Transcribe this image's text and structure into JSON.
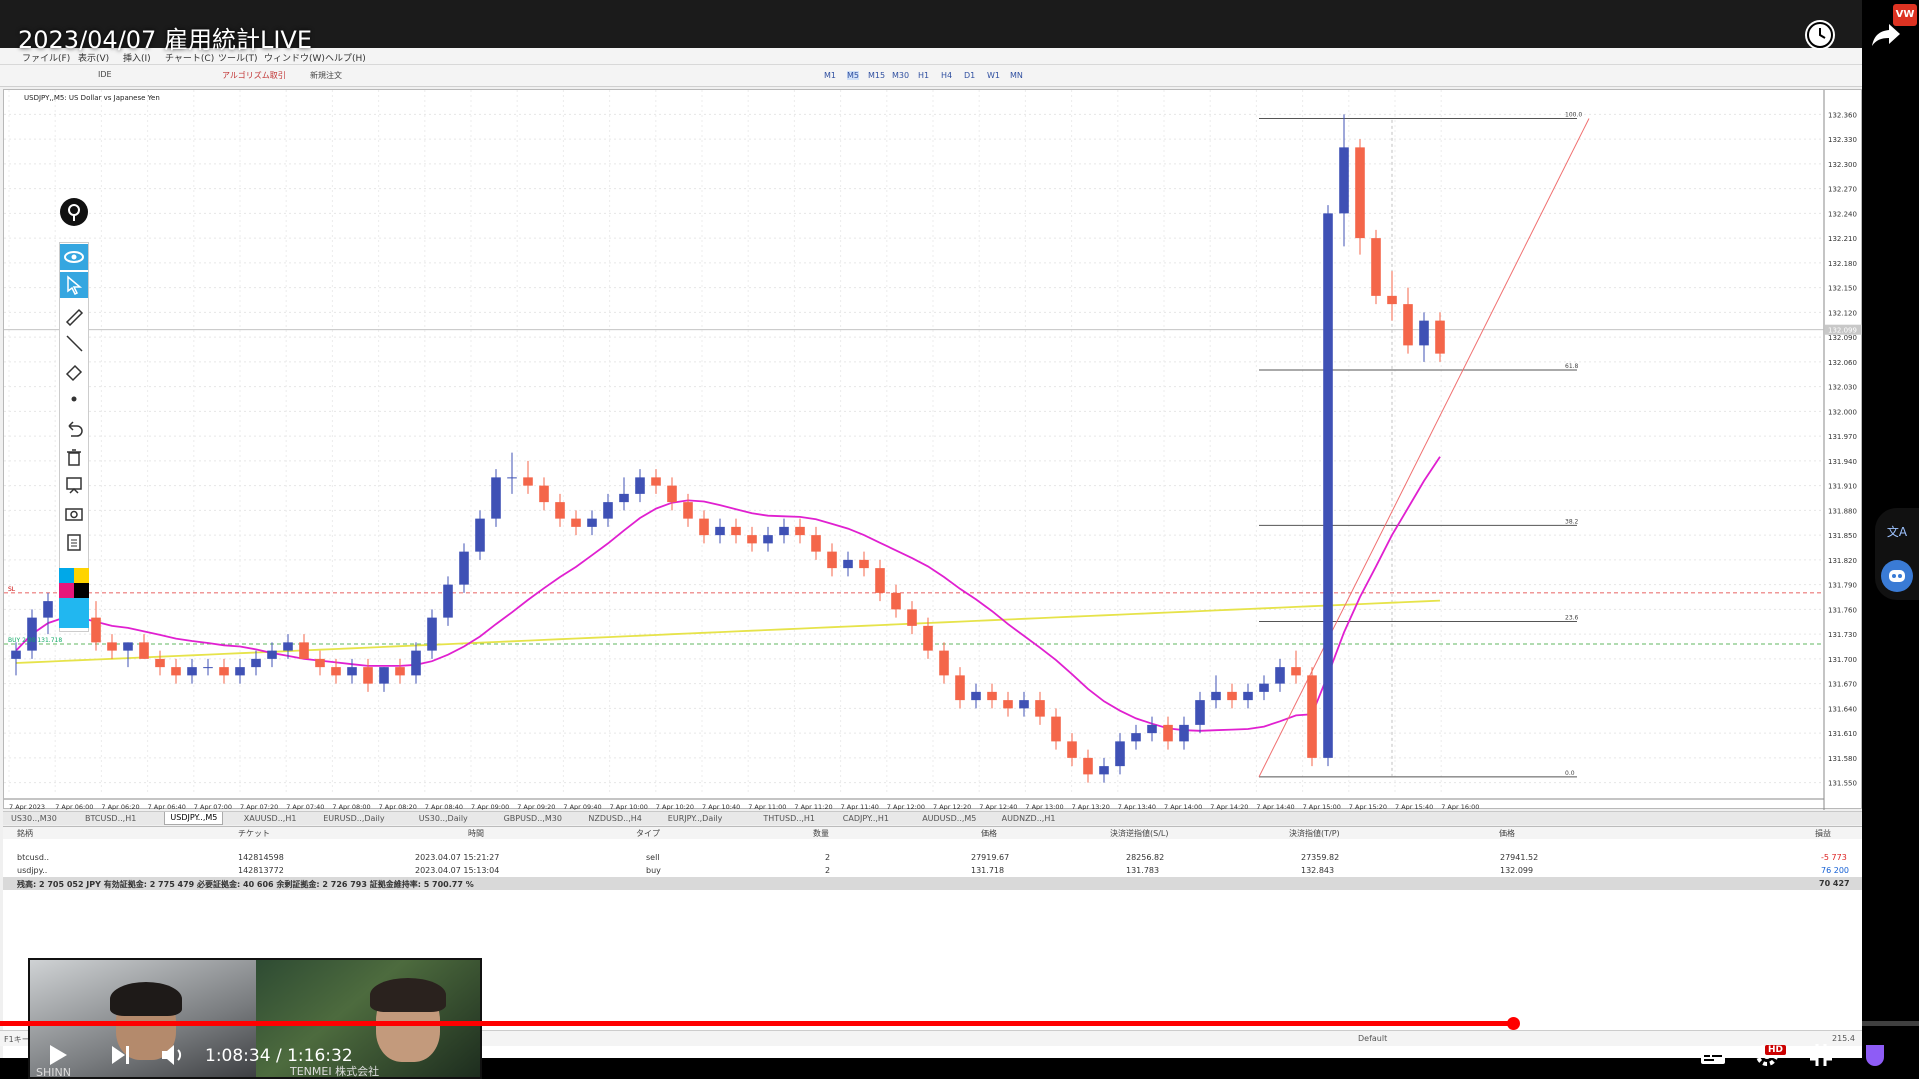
{
  "video": {
    "title": "2023/04/07 雇用統計LIVE",
    "time_current": "1:08:34",
    "time_total": "1:16:32",
    "time_separator": " / ",
    "progress": 0.896,
    "hd_badge": "HD",
    "vw_badge": "VW",
    "pip_left_name": "SHINN",
    "pip_right_name": "TENMEI 株式会社",
    "side_letter": "文A"
  },
  "menu": {
    "items": [
      "ファイル(F)",
      "表示(V)",
      "挿入(I)",
      "チャート(C)",
      "ツール(T)",
      "ウィンドウ(W)",
      "ヘルプ(H)"
    ]
  },
  "toolbar": {
    "algo_label": "アルゴリズム取引",
    "new_order_label": "新規注文",
    "ide_label": "IDE",
    "timeframes": [
      "M1",
      "M5",
      "M15",
      "M30",
      "H1",
      "H4",
      "D1",
      "W1",
      "MN"
    ],
    "active_timeframe": "M5"
  },
  "chart": {
    "header": "USDJPY,,M5: US Dollar vs Japanese Yen",
    "sl_label": "SL",
    "buy_label": "BUY 2.00 131.718",
    "current_price": "132.099"
  },
  "chart_data": {
    "type": "candlestick",
    "symbol": "USDJPY",
    "timeframe": "M5",
    "yaxis_ticks": [
      "132.360",
      "132.330",
      "132.300",
      "132.270",
      "132.240",
      "132.210",
      "132.180",
      "132.150",
      "132.120",
      "132.090",
      "132.060",
      "132.030",
      "132.000",
      "131.970",
      "131.940",
      "131.910",
      "131.880",
      "131.850",
      "131.820",
      "131.790",
      "131.760",
      "131.730",
      "131.700",
      "131.670",
      "131.640",
      "131.610",
      "131.580",
      "131.550"
    ],
    "xaxis_ticks": [
      "7 Apr 2023",
      "7 Apr 06:00",
      "7 Apr 06:20",
      "7 Apr 06:40",
      "7 Apr 07:00",
      "7 Apr 07:20",
      "7 Apr 07:40",
      "7 Apr 08:00",
      "7 Apr 08:20",
      "7 Apr 08:40",
      "7 Apr 09:00",
      "7 Apr 09:20",
      "7 Apr 09:40",
      "7 Apr 10:00",
      "7 Apr 10:20",
      "7 Apr 10:40",
      "7 Apr 11:00",
      "7 Apr 11:20",
      "7 Apr 11:40",
      "7 Apr 12:00",
      "7 Apr 12:20",
      "7 Apr 12:40",
      "7 Apr 13:00",
      "7 Apr 13:20",
      "7 Apr 13:40",
      "7 Apr 14:00",
      "7 Apr 14:20",
      "7 Apr 14:40",
      "7 Apr 15:00",
      "7 Apr 15:20",
      "7 Apr 15:40",
      "7 Apr 16:00"
    ],
    "fibo_levels": [
      "100.0",
      "61.8",
      "38.2",
      "23.6",
      "0.0"
    ],
    "candles": [
      [
        131.7,
        131.72,
        131.68,
        131.71
      ],
      [
        131.71,
        131.76,
        131.7,
        131.75
      ],
      [
        131.75,
        131.78,
        131.73,
        131.77
      ],
      [
        131.77,
        131.79,
        131.76,
        131.77
      ],
      [
        131.77,
        131.78,
        131.74,
        131.75
      ],
      [
        131.75,
        131.77,
        131.71,
        131.72
      ],
      [
        131.72,
        131.73,
        131.7,
        131.71
      ],
      [
        131.71,
        131.72,
        131.69,
        131.72
      ],
      [
        131.72,
        131.73,
        131.7,
        131.7
      ],
      [
        131.7,
        131.71,
        131.68,
        131.69
      ],
      [
        131.69,
        131.7,
        131.67,
        131.68
      ],
      [
        131.68,
        131.7,
        131.67,
        131.69
      ],
      [
        131.69,
        131.7,
        131.68,
        131.69
      ],
      [
        131.69,
        131.7,
        131.67,
        131.68
      ],
      [
        131.68,
        131.7,
        131.67,
        131.69
      ],
      [
        131.69,
        131.71,
        131.68,
        131.7
      ],
      [
        131.7,
        131.72,
        131.69,
        131.71
      ],
      [
        131.71,
        131.73,
        131.7,
        131.72
      ],
      [
        131.72,
        131.73,
        131.7,
        131.7
      ],
      [
        131.7,
        131.71,
        131.68,
        131.69
      ],
      [
        131.69,
        131.7,
        131.67,
        131.68
      ],
      [
        131.68,
        131.7,
        131.67,
        131.69
      ],
      [
        131.69,
        131.7,
        131.66,
        131.67
      ],
      [
        131.67,
        131.69,
        131.66,
        131.69
      ],
      [
        131.69,
        131.7,
        131.67,
        131.68
      ],
      [
        131.68,
        131.72,
        131.67,
        131.71
      ],
      [
        131.71,
        131.76,
        131.7,
        131.75
      ],
      [
        131.75,
        131.8,
        131.74,
        131.79
      ],
      [
        131.79,
        131.84,
        131.78,
        131.83
      ],
      [
        131.83,
        131.88,
        131.82,
        131.87
      ],
      [
        131.87,
        131.93,
        131.86,
        131.92
      ],
      [
        131.92,
        131.95,
        131.9,
        131.92
      ],
      [
        131.92,
        131.94,
        131.9,
        131.91
      ],
      [
        131.91,
        131.92,
        131.88,
        131.89
      ],
      [
        131.89,
        131.9,
        131.86,
        131.87
      ],
      [
        131.87,
        131.88,
        131.85,
        131.86
      ],
      [
        131.86,
        131.88,
        131.85,
        131.87
      ],
      [
        131.87,
        131.9,
        131.86,
        131.89
      ],
      [
        131.89,
        131.92,
        131.88,
        131.9
      ],
      [
        131.9,
        131.93,
        131.89,
        131.92
      ],
      [
        131.92,
        131.93,
        131.9,
        131.91
      ],
      [
        131.91,
        131.92,
        131.88,
        131.89
      ],
      [
        131.89,
        131.9,
        131.86,
        131.87
      ],
      [
        131.87,
        131.88,
        131.84,
        131.85
      ],
      [
        131.85,
        131.87,
        131.84,
        131.86
      ],
      [
        131.86,
        131.87,
        131.84,
        131.85
      ],
      [
        131.85,
        131.86,
        131.83,
        131.84
      ],
      [
        131.84,
        131.86,
        131.83,
        131.85
      ],
      [
        131.85,
        131.87,
        131.84,
        131.86
      ],
      [
        131.86,
        131.87,
        131.84,
        131.85
      ],
      [
        131.85,
        131.86,
        131.82,
        131.83
      ],
      [
        131.83,
        131.84,
        131.8,
        131.81
      ],
      [
        131.81,
        131.83,
        131.8,
        131.82
      ],
      [
        131.82,
        131.83,
        131.8,
        131.81
      ],
      [
        131.81,
        131.82,
        131.77,
        131.78
      ],
      [
        131.78,
        131.79,
        131.75,
        131.76
      ],
      [
        131.76,
        131.77,
        131.73,
        131.74
      ],
      [
        131.74,
        131.75,
        131.7,
        131.71
      ],
      [
        131.71,
        131.72,
        131.67,
        131.68
      ],
      [
        131.68,
        131.69,
        131.64,
        131.65
      ],
      [
        131.65,
        131.67,
        131.64,
        131.66
      ],
      [
        131.66,
        131.67,
        131.64,
        131.65
      ],
      [
        131.65,
        131.66,
        131.63,
        131.64
      ],
      [
        131.64,
        131.66,
        131.63,
        131.65
      ],
      [
        131.65,
        131.66,
        131.62,
        131.63
      ],
      [
        131.63,
        131.64,
        131.59,
        131.6
      ],
      [
        131.6,
        131.61,
        131.57,
        131.58
      ],
      [
        131.58,
        131.59,
        131.55,
        131.56
      ],
      [
        131.56,
        131.58,
        131.55,
        131.57
      ],
      [
        131.57,
        131.61,
        131.56,
        131.6
      ],
      [
        131.6,
        131.62,
        131.59,
        131.61
      ],
      [
        131.61,
        131.63,
        131.6,
        131.62
      ],
      [
        131.62,
        131.63,
        131.59,
        131.6
      ],
      [
        131.6,
        131.63,
        131.59,
        131.62
      ],
      [
        131.62,
        131.66,
        131.61,
        131.65
      ],
      [
        131.65,
        131.68,
        131.64,
        131.66
      ],
      [
        131.66,
        131.67,
        131.64,
        131.65
      ],
      [
        131.65,
        131.67,
        131.64,
        131.66
      ],
      [
        131.66,
        131.68,
        131.65,
        131.67
      ],
      [
        131.67,
        131.7,
        131.66,
        131.69
      ],
      [
        131.69,
        131.71,
        131.67,
        131.68
      ],
      [
        131.68,
        131.69,
        131.57,
        131.58
      ],
      [
        131.58,
        132.25,
        131.57,
        132.24
      ],
      [
        132.24,
        132.36,
        132.2,
        132.32
      ],
      [
        132.32,
        132.33,
        132.19,
        132.21
      ],
      [
        132.21,
        132.22,
        132.13,
        132.14
      ],
      [
        132.14,
        132.17,
        132.11,
        132.13
      ],
      [
        132.13,
        132.15,
        132.07,
        132.08
      ],
      [
        132.08,
        132.12,
        132.06,
        132.11
      ],
      [
        132.11,
        132.12,
        132.06,
        132.07
      ]
    ]
  },
  "chart_tabs": [
    "US30..,M30",
    "BTCUSD..,H1",
    "USDJPY..,M5",
    "XAUUSD..,H1",
    "EURUSD..,Daily",
    "US30..,Daily",
    "GBPUSD..,M30",
    "NZDUSD..,H4",
    "EURJPY..,Daily",
    "THTUSD..,H1",
    "CADJPY..,H1",
    "AUDUSD..,M5",
    "AUDNZD..,H1"
  ],
  "active_chart_tab": "USDJPY..,M5",
  "terminal": {
    "headers": [
      "銘柄",
      "チケット",
      "時間",
      "タイプ",
      "数量",
      "価格",
      "決済逆指値(S/L)",
      "決済指値(T/P)",
      "価格",
      "損益"
    ],
    "rows": [
      {
        "symbol": "btcusd..",
        "ticket": "142814598",
        "time": "2023.04.07 15:21:27",
        "type": "sell",
        "volume": "2",
        "price": "27919.67",
        "sl": "28256.82",
        "tp": "27359.82",
        "current": "27941.52",
        "profit": "-5 773"
      },
      {
        "symbol": "usdjpy..",
        "ticket": "142813772",
        "time": "2023.04.07 15:13:04",
        "type": "buy",
        "volume": "2",
        "price": "131.718",
        "sl": "131.783",
        "tp": "132.843",
        "current": "132.099",
        "profit": "76 200"
      }
    ],
    "balance_line": "残高: 2 705 052 JPY  有効証拠金: 2 775 479  必要証拠金: 40 606  余剰証拠金: 2 726 793  証拠金維持率: 5 700.77 %",
    "balance_total": "70 427"
  },
  "status": {
    "left": "F1キー",
    "default_label": "Default",
    "right_info": "215.4"
  },
  "colors": {
    "bull": "#3f51b5",
    "bear": "#f4664a",
    "ma_fast": "#e020d0",
    "ma_slow": "#e6e34a",
    "trend": "#f07070",
    "progress": "#ff0000"
  }
}
